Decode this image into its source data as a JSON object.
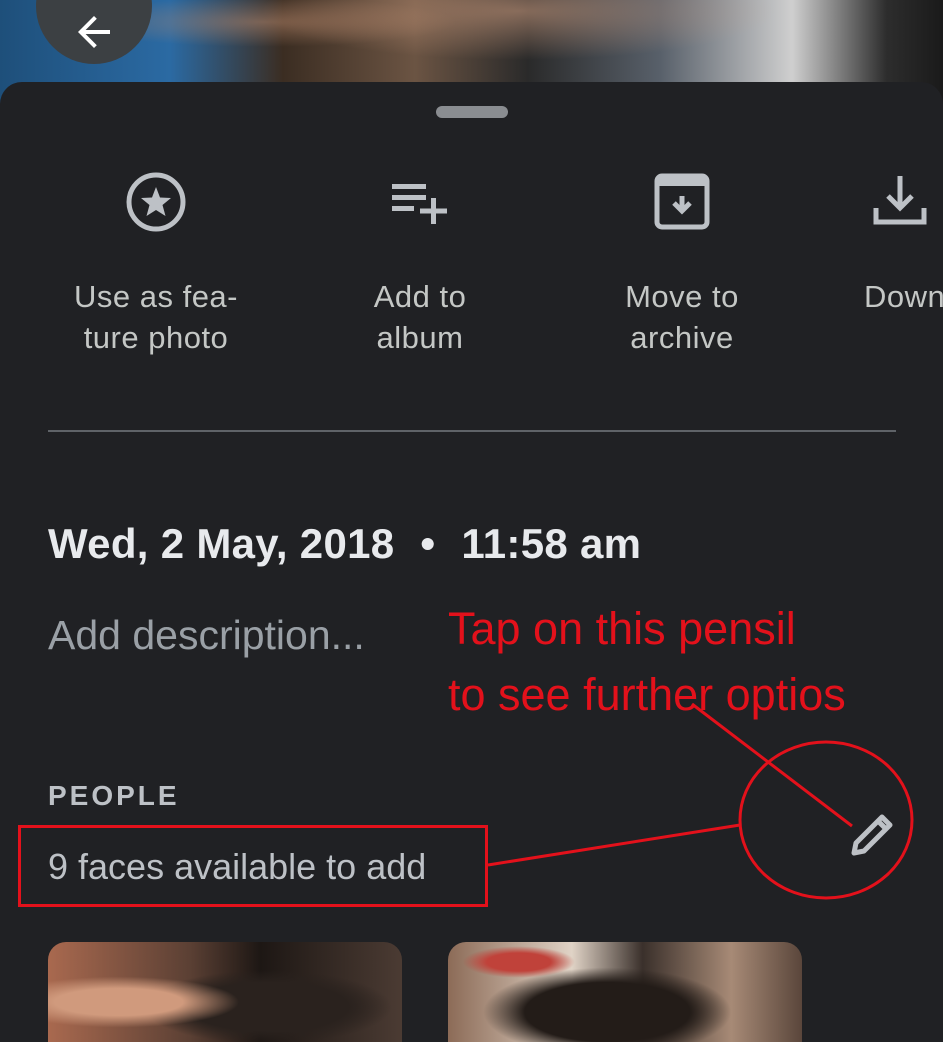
{
  "header": {
    "back_icon": "arrow-left-icon"
  },
  "actions": [
    {
      "label": "Use as fea-\nture photo",
      "icon": "star-circle-icon"
    },
    {
      "label": "Add to\nalbum",
      "icon": "playlist-add-icon"
    },
    {
      "label": "Move to\narchive",
      "icon": "archive-icon"
    },
    {
      "label": "Down",
      "icon": "download-icon"
    }
  ],
  "info": {
    "date": "Wed, 2 May, 2018",
    "separator": "•",
    "time": "11:58 am",
    "description_placeholder": "Add description..."
  },
  "people": {
    "heading": "PEOPLE",
    "faces_text": "9 faces available to add",
    "edit_icon": "pencil-icon"
  },
  "annotation": {
    "line1": "Tap on this pensil",
    "line2": "to see further optios",
    "color": "#e3111b"
  },
  "colors": {
    "background": "#202124",
    "text_primary": "#e8eaed",
    "text_secondary": "#bdc1c6",
    "icon": "#bdc1c6"
  }
}
